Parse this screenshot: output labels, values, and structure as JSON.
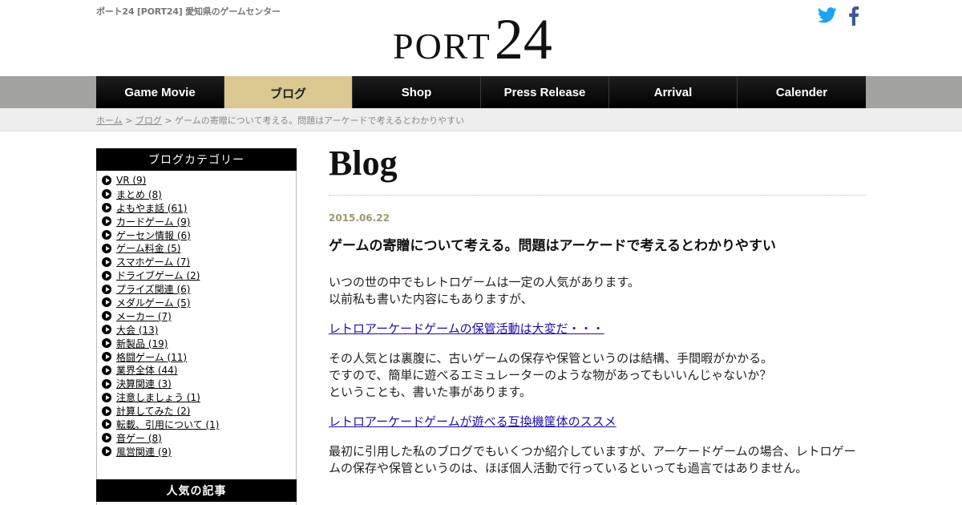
{
  "site": {
    "tagline": "ポート24 [PORT24] 愛知県のゲームセンター",
    "logo_word": "PORT",
    "logo_number": "24"
  },
  "social": [
    {
      "name": "twitter",
      "icon": "twitter-bird-icon",
      "color": "#1da1f2"
    },
    {
      "name": "facebook",
      "icon": "facebook-f-icon",
      "color": "#3b5998"
    }
  ],
  "nav": {
    "items": [
      {
        "label": "Game Movie",
        "active": false
      },
      {
        "label": "ブログ",
        "active": true
      },
      {
        "label": "Shop",
        "active": false
      },
      {
        "label": "Press Release",
        "active": false
      },
      {
        "label": "Arrival",
        "active": false
      },
      {
        "label": "Calender",
        "active": false
      }
    ],
    "active_color": "#dac890"
  },
  "breadcrumb": {
    "home": "ホーム",
    "sep1": " > ",
    "blog": "ブログ",
    "sep2": " > ",
    "current": "ゲームの寄贈について考える。問題はアーケードで考えるとわかりやすい"
  },
  "sidebar": {
    "category_title": "ブログカテゴリー",
    "categories": [
      "VR (9)",
      "まとめ (8)",
      "よもやま話 (61)",
      "カードゲーム (9)",
      "ゲーセン情報 (6)",
      "ゲーム料金 (5)",
      "スマホゲーム (7)",
      "ドライブゲーム (2)",
      "プライズ関連 (6)",
      "メダルゲーム (5)",
      "メーカー (7)",
      "大会 (13)",
      "新製品 (19)",
      "格闘ゲーム (11)",
      "業界全体 (44)",
      "決算関連 (3)",
      "注意しましょう (1)",
      "計算してみた (2)",
      "転載、引用について (1)",
      "音ゲー (8)",
      "風営関連 (9)"
    ],
    "popular_title": "人気の記事"
  },
  "main": {
    "heading": "Blog",
    "post": {
      "date": "2015.06.22",
      "title": "ゲームの寄贈について考える。問題はアーケードで考えるとわかりやすい",
      "p1_line1": "いつの世の中でもレトロゲームは一定の人気があります。",
      "p1_line2": "以前私も書いた内容にもありますが、",
      "link1": "レトロアーケードゲームの保管活動は大変だ・・・",
      "p2_line1": "その人気とは裏腹に、古いゲームの保存や保管というのは結構、手間暇がかかる。",
      "p2_line2": "ですので、簡単に遊べるエミュレーターのような物があってもいいんじゃないか？",
      "p2_line3": "ということも、書いた事があります。",
      "link2": "レトロアーケードゲームが遊べる互換機筐体のススメ",
      "p3": "最初に引用した私のブログでもいくつか紹介していますが、アーケードゲームの場合、レトロゲームの保存や保管というのは、ほぼ個人活動で行っているといっても過言ではありません。"
    }
  }
}
